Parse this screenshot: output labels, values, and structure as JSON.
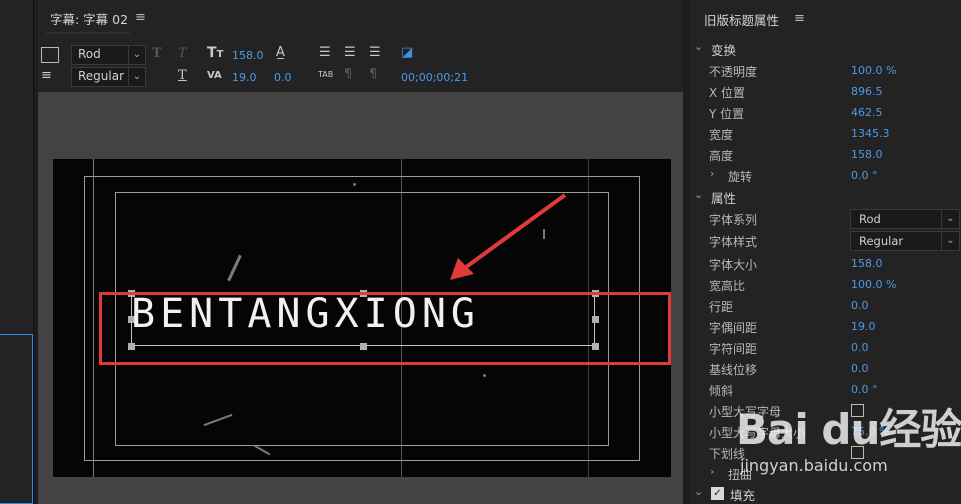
{
  "title_panel": {
    "tab_label": "字幕: 字幕 02",
    "font_family": "Rod",
    "font_style": "Regular",
    "font_size": "158.0",
    "tracking": "19.0",
    "leading": "0.0",
    "timecode": "00;00;00;21",
    "tab_stops_icon_label": "TAB"
  },
  "canvas": {
    "title_text": "BENTANGXIONG"
  },
  "properties": {
    "panel_title": "旧版标题属性",
    "sections": {
      "transform": "变换",
      "properties": "属性",
      "fill": "填充"
    },
    "transform_rows": [
      {
        "label": "不透明度",
        "value": "100.0 %"
      },
      {
        "label": "X 位置",
        "value": "896.5"
      },
      {
        "label": "Y 位置",
        "value": "462.5"
      },
      {
        "label": "宽度",
        "value": "1345.3"
      },
      {
        "label": "高度",
        "value": "158.0"
      },
      {
        "label": "旋转",
        "value": "0.0 °"
      }
    ],
    "font_family": {
      "label": "字体系列",
      "value": "Rod"
    },
    "font_style": {
      "label": "字体样式",
      "value": "Regular"
    },
    "attr_rows": [
      {
        "label": "字体大小",
        "value": "158.0"
      },
      {
        "label": "宽高比",
        "value": "100.0 %"
      },
      {
        "label": "行距",
        "value": "0.0"
      },
      {
        "label": "字偶间距",
        "value": "19.0"
      },
      {
        "label": "字符间距",
        "value": "0.0"
      },
      {
        "label": "基线位移",
        "value": "0.0"
      },
      {
        "label": "倾斜",
        "value": "0.0 °"
      }
    ],
    "small_caps": {
      "label": "小型大写字母"
    },
    "small_caps_size": {
      "label": "小型大写字母大小",
      "value": "75.0 %"
    },
    "underline": {
      "label": "下划线"
    },
    "distort": {
      "label": "扭曲"
    }
  },
  "watermark": {
    "logo": "Bai du经验",
    "url": "jingyan.baidu.com"
  }
}
